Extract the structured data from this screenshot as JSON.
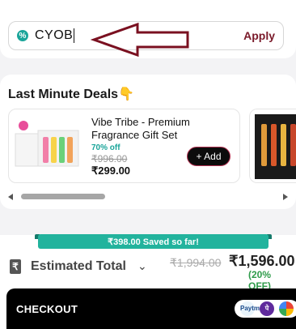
{
  "coupon": {
    "code": "CYOB",
    "icon": "percent-badge-icon",
    "apply_label": "Apply",
    "accent": "#1aa59a",
    "apply_color": "#7a1a2a"
  },
  "annotation": {
    "icon": "pointing-arrow-icon",
    "color": "#7a1020"
  },
  "deals": {
    "title": "Last Minute Deals",
    "title_emoji": "👇",
    "items": [
      {
        "name": "Vibe Tribe - Premium Fragrance Gift Set",
        "discount": "70% off",
        "mrp": "₹996.00",
        "price": "₹299.00",
        "add_label": "+ Add"
      }
    ]
  },
  "savings": {
    "text": "₹398.00 Saved so far!",
    "color": "#22b39d"
  },
  "total": {
    "label": "Estimated Total",
    "mrp": "₹1,994.00",
    "price": "₹1,596.00",
    "off": "(20% OFF)"
  },
  "checkout": {
    "label": "CHECKOUT",
    "payment_icons": [
      "paytm-icon",
      "phonepe-icon",
      "gpay-icon"
    ],
    "paytm_text": "Paytm",
    "phonepe_text": "पे"
  }
}
